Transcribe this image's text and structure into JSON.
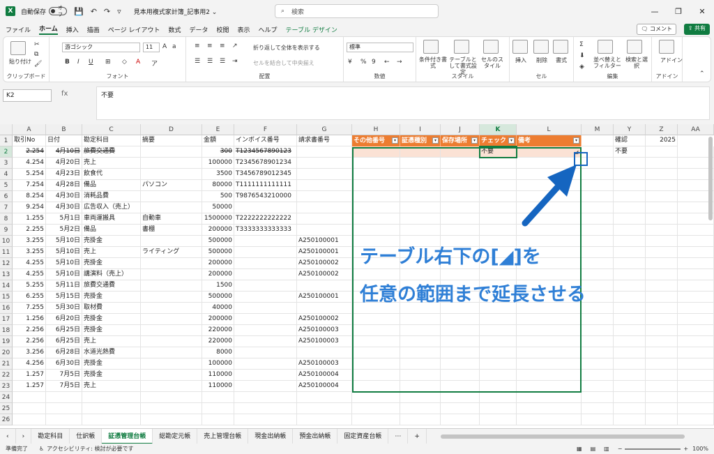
{
  "titlebar": {
    "app_logo": "X",
    "autosave_label": "自動保存",
    "autosave_state": "オフ",
    "doc_title": "見本用複式家計簿_記事用2 ⌄",
    "search_placeholder": "検索"
  },
  "menu": [
    "ファイル",
    "ホーム",
    "挿入",
    "描画",
    "ページ レイアウト",
    "数式",
    "データ",
    "校閲",
    "表示",
    "ヘルプ",
    "テーブル デザイン"
  ],
  "menu_active": "ホーム",
  "comment_label": "コメント",
  "share_label": "共有",
  "ribbon": {
    "clipboard": {
      "label": "クリップボード",
      "paste": "貼り付け"
    },
    "font": {
      "label": "フォント",
      "name": "游ゴシック",
      "size": "11"
    },
    "alignment": {
      "label": "配置",
      "wrap": "折り返して全体を表示する",
      "merge": "セルを結合して中央揃え"
    },
    "number": {
      "label": "数値",
      "format": "標準"
    },
    "style": {
      "label": "スタイル",
      "conditional": "条件付き書式",
      "table": "テーブルとして書式設定",
      "cell": "セルのスタイル"
    },
    "cells": {
      "label": "セル",
      "insert": "挿入",
      "delete": "削除",
      "format": "書式"
    },
    "editing": {
      "label": "編集",
      "sort": "並べ替えとフィルター",
      "find": "検索と選択"
    },
    "addins": {
      "label": "アドイン",
      "addin": "アドイン"
    }
  },
  "formula": {
    "namebox": "K2",
    "fx": "fx",
    "content": "不要"
  },
  "columns": [
    "A",
    "B",
    "C",
    "D",
    "E",
    "F",
    "G",
    "H",
    "I",
    "J",
    "K",
    "L",
    "M",
    "Y",
    "Z",
    "AA"
  ],
  "header_row": [
    "取引No",
    "日付",
    "勘定科目",
    "摘要",
    "金額",
    "インボイス番号",
    "請求書番号"
  ],
  "table_headers": [
    "その他番号",
    "証憑種別",
    "保存場所",
    "チェック",
    "備考"
  ],
  "extra_header": {
    "y": "確認",
    "z": "2025"
  },
  "rows": [
    {
      "n": "2",
      "a": "2.254",
      "b": "4月10日",
      "c": "旅費交通費",
      "d": "",
      "e": "300",
      "f": "T1234567890123",
      "g": "",
      "k": "不要",
      "y": "不要",
      "strike": true
    },
    {
      "n": "3",
      "a": "4.254",
      "b": "4月20日",
      "c": "売上",
      "d": "",
      "e": "100000",
      "f": "T2345678901234",
      "g": ""
    },
    {
      "n": "4",
      "a": "5.254",
      "b": "4月23日",
      "c": "飲食代",
      "d": "",
      "e": "3500",
      "f": "T3456789012345",
      "g": ""
    },
    {
      "n": "5",
      "a": "7.254",
      "b": "4月28日",
      "c": "備品",
      "d": "パソコン",
      "e": "80000",
      "f": "T1111111111111",
      "g": ""
    },
    {
      "n": "6",
      "a": "8.254",
      "b": "4月30日",
      "c": "消耗品費",
      "d": "",
      "e": "500",
      "f": "T9876543210000",
      "g": ""
    },
    {
      "n": "7",
      "a": "9.254",
      "b": "4月30日",
      "c": "広告収入（売上）",
      "d": "",
      "e": "50000",
      "f": "",
      "g": ""
    },
    {
      "n": "8",
      "a": "1.255",
      "b": "5月1日",
      "c": "車両運搬具",
      "d": "自動車",
      "e": "1500000",
      "f": "T2222222222222",
      "g": ""
    },
    {
      "n": "9",
      "a": "2.255",
      "b": "5月2日",
      "c": "備品",
      "d": "書棚",
      "e": "200000",
      "f": "T3333333333333",
      "g": ""
    },
    {
      "n": "10",
      "a": "3.255",
      "b": "5月10日",
      "c": "売掛金",
      "d": "",
      "e": "500000",
      "f": "",
      "g": "A250100001"
    },
    {
      "n": "11",
      "a": "3.255",
      "b": "5月10日",
      "c": "売上",
      "d": "ライティング",
      "e": "500000",
      "f": "",
      "g": "A250100001"
    },
    {
      "n": "12",
      "a": "4.255",
      "b": "5月10日",
      "c": "売掛金",
      "d": "",
      "e": "200000",
      "f": "",
      "g": "A250100002"
    },
    {
      "n": "13",
      "a": "4.255",
      "b": "5月10日",
      "c": "講演料（売上）",
      "d": "",
      "e": "200000",
      "f": "",
      "g": "A250100002"
    },
    {
      "n": "14",
      "a": "5.255",
      "b": "5月11日",
      "c": "旅費交通費",
      "d": "",
      "e": "1500",
      "f": "",
      "g": ""
    },
    {
      "n": "15",
      "a": "6.255",
      "b": "5月15日",
      "c": "売掛金",
      "d": "",
      "e": "500000",
      "f": "",
      "g": "A250100001"
    },
    {
      "n": "16",
      "a": "7.255",
      "b": "5月30日",
      "c": "取材費",
      "d": "",
      "e": "40000",
      "f": "",
      "g": ""
    },
    {
      "n": "17",
      "a": "1.256",
      "b": "6月20日",
      "c": "売掛金",
      "d": "",
      "e": "200000",
      "f": "",
      "g": "A250100002"
    },
    {
      "n": "18",
      "a": "2.256",
      "b": "6月25日",
      "c": "売掛金",
      "d": "",
      "e": "220000",
      "f": "",
      "g": "A250100003"
    },
    {
      "n": "19",
      "a": "2.256",
      "b": "6月25日",
      "c": "売上",
      "d": "",
      "e": "220000",
      "f": "",
      "g": "A250100003"
    },
    {
      "n": "20",
      "a": "3.256",
      "b": "6月28日",
      "c": "水道光熱費",
      "d": "",
      "e": "8000",
      "f": "",
      "g": ""
    },
    {
      "n": "21",
      "a": "4.256",
      "b": "6月30日",
      "c": "売掛金",
      "d": "",
      "e": "100000",
      "f": "",
      "g": "A250100003"
    },
    {
      "n": "22",
      "a": "1.257",
      "b": "7月5日",
      "c": "売掛金",
      "d": "",
      "e": "110000",
      "f": "",
      "g": "A250100004"
    },
    {
      "n": "23",
      "a": "1.257",
      "b": "7月5日",
      "c": "売上",
      "d": "",
      "e": "110000",
      "f": "",
      "g": "A250100004"
    },
    {
      "n": "24"
    },
    {
      "n": "25"
    },
    {
      "n": "26"
    }
  ],
  "annotation": {
    "line1": "テーブル右下の[◢]を",
    "line2": "任意の範囲まで延長させる"
  },
  "sheets": [
    "勘定科目",
    "仕訳帳",
    "証憑管理台帳",
    "総勘定元帳",
    "売上管理台帳",
    "現金出納帳",
    "預金出納帳",
    "固定資産台帳"
  ],
  "active_sheet": "証憑管理台帳",
  "status": {
    "ready": "準備完了",
    "accessibility": "アクセシビリティ: 検討が必要です",
    "zoom": "100%"
  },
  "colors": {
    "excel_green": "#107c41",
    "table_orange": "#ed7d31",
    "annotation_blue": "#2f7fd6"
  }
}
